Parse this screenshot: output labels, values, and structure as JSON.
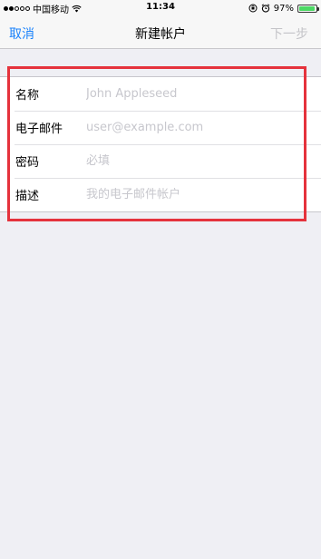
{
  "status_bar": {
    "carrier": "中国移动",
    "time": "11:34",
    "battery_percent": "97%",
    "signal_bars_on": 2,
    "signal_bars_total": 5
  },
  "nav": {
    "cancel_label": "取消",
    "title": "新建帐户",
    "next_label": "下一步"
  },
  "form": {
    "fields": [
      {
        "label": "名称",
        "placeholder": "John Appleseed",
        "value": ""
      },
      {
        "label": "电子邮件",
        "placeholder": "user@example.com",
        "value": ""
      },
      {
        "label": "密码",
        "placeholder": "必填",
        "value": ""
      },
      {
        "label": "描述",
        "placeholder": "我的电子邮件帐户",
        "value": ""
      }
    ]
  },
  "colors": {
    "accent": "#1a82fb",
    "disabled": "#c4c4c8",
    "highlight": "#e5323c",
    "background": "#efeff4",
    "battery": "#4cd964"
  }
}
